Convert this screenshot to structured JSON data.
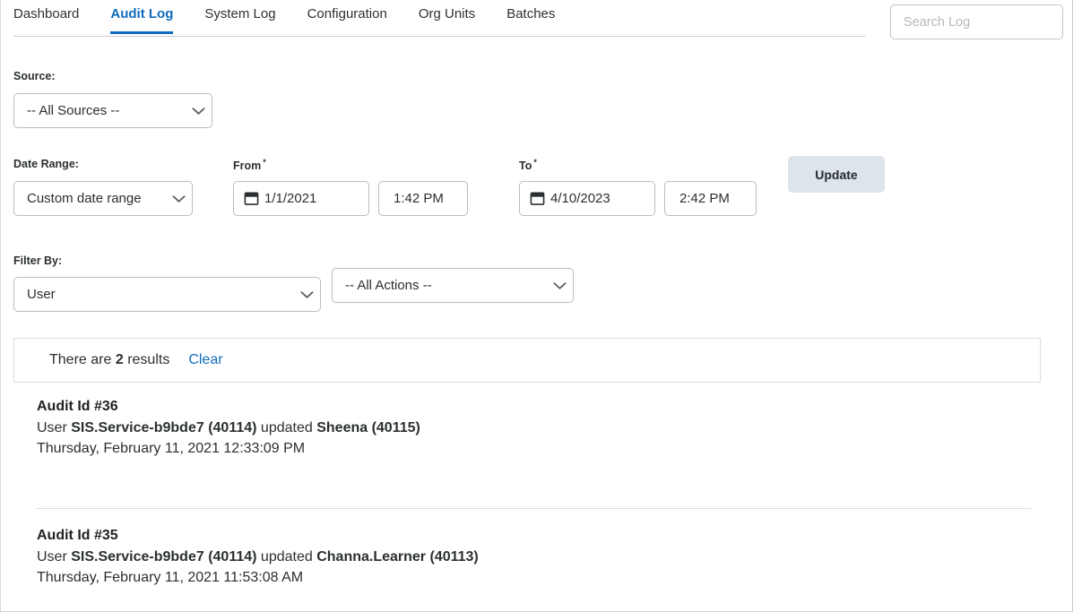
{
  "tabs": [
    {
      "label": "Dashboard",
      "active": false
    },
    {
      "label": "Audit Log",
      "active": true
    },
    {
      "label": "System Log",
      "active": false
    },
    {
      "label": "Configuration",
      "active": false
    },
    {
      "label": "Org Units",
      "active": false
    },
    {
      "label": "Batches",
      "active": false
    }
  ],
  "search": {
    "placeholder": "Search Log",
    "value": "",
    "icon": "search-icon"
  },
  "filters": {
    "source": {
      "label": "Source:",
      "value": "-- All Sources --"
    },
    "date_range": {
      "label": "Date Range:",
      "value": "Custom date range"
    },
    "from": {
      "label": "From",
      "required_marker": "*",
      "date": "1/1/2021",
      "time": "1:42 PM",
      "icon": "calendar-icon"
    },
    "to": {
      "label": "To",
      "required_marker": "*",
      "date": "4/10/2023",
      "time": "2:42 PM",
      "icon": "calendar-icon"
    },
    "update_button": "Update",
    "filter_by": {
      "label": "Filter By:",
      "value": "User",
      "action_value": "-- All Actions --"
    }
  },
  "results": {
    "prefix": "There are",
    "count": "2",
    "suffix": "results",
    "clear_label": "Clear",
    "records": [
      {
        "title": "Audit Id #36",
        "line_prefix": "User",
        "actor": "SIS.Service-b9bde7 (40114)",
        "action": "updated",
        "target": "Sheena (40115)",
        "timestamp": "Thursday, February 11, 2021 12:33:09 PM"
      },
      {
        "title": "Audit Id #35",
        "line_prefix": "User",
        "actor": "SIS.Service-b9bde7 (40114)",
        "action": "updated",
        "target": "Channa.Learner (40113)",
        "timestamp": "Thursday, February 11, 2021 11:53:08 AM"
      }
    ]
  },
  "colors": {
    "accent": "#0f6cbd",
    "button_bg": "#dde4ec",
    "border": "#b9bdc2"
  }
}
